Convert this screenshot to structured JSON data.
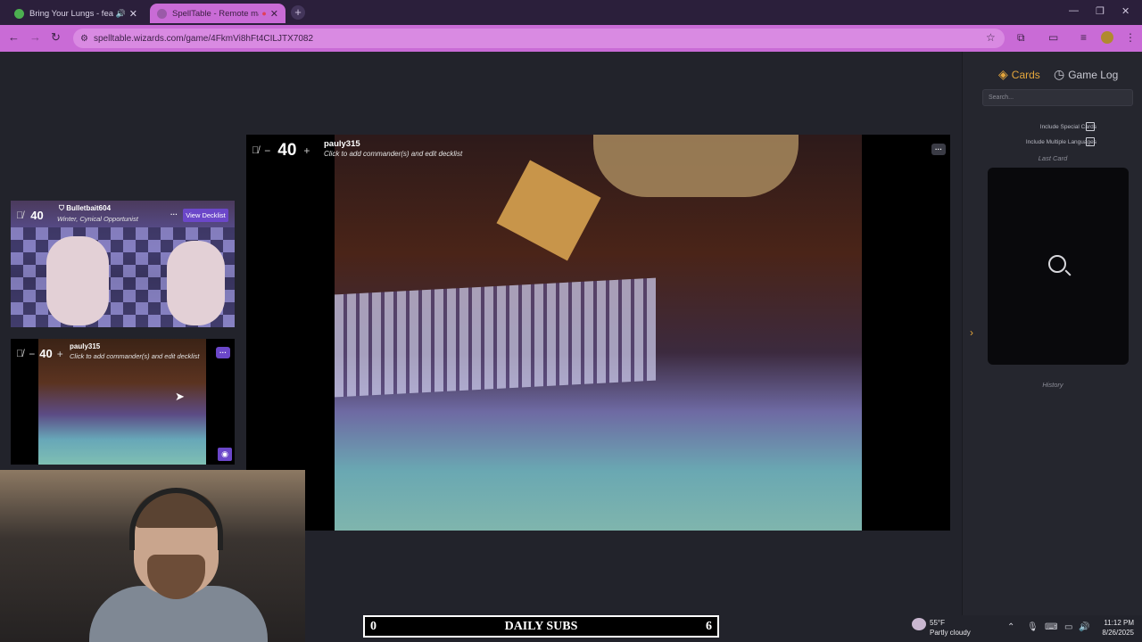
{
  "browser": {
    "tabs": [
      {
        "title": "Bring Your Lungs - feat. Sm",
        "active": false,
        "audio": true
      },
      {
        "title": "SpellTable - Remote magic",
        "active": true,
        "audio": false
      }
    ],
    "url": "spelltable.wizards.com/game/4FkmVi8hFt4CILJTX7082",
    "colors": {
      "tabstrip": "#2b1f3b",
      "toolbar": "#c96bd6"
    }
  },
  "main_player": {
    "life": "40",
    "name": "pauly315",
    "hint": "Click to add commander(s) and edit decklist"
  },
  "players": [
    {
      "life": "40",
      "name": "Bulletbait604",
      "subtitle": "Winter, Cynical Opportunist",
      "view_decklist": "View Decklist"
    },
    {
      "life": "40",
      "name": "pauly315",
      "subtitle": "Click to add commander(s) and edit decklist"
    }
  ],
  "controls": {
    "minus": "−",
    "plus": "+",
    "dots": "···"
  },
  "subs_bar": {
    "left": "0",
    "label": "DAILY SUBS",
    "right": "6"
  },
  "sidebar": {
    "tab_cards": "Cards",
    "tab_game_log": "Game Log",
    "search_placeholder": "Search...",
    "include_special": "Include Special Cards",
    "include_languages": "Include Multiple Languages",
    "last_card": "Last Card",
    "history": "History",
    "accent": "#e4a63c"
  },
  "taskbar": {
    "temperature": "55°F",
    "condition": "Partly cloudy",
    "time": "11:12 PM",
    "date": "8/26/2025"
  }
}
